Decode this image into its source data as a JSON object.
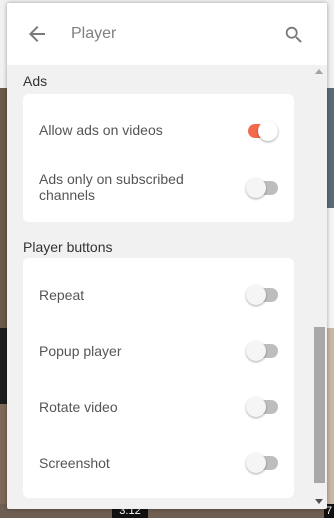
{
  "header": {
    "title": "Player",
    "back_icon": "arrow-back-icon",
    "search_icon": "search-icon"
  },
  "sections": [
    {
      "title": "Ads",
      "items": [
        {
          "label": "Allow ads on videos",
          "enabled": true
        },
        {
          "label": "Ads only on subscribed channels",
          "enabled": false
        }
      ]
    },
    {
      "title": "Player buttons",
      "items": [
        {
          "label": "Repeat",
          "enabled": false
        },
        {
          "label": "Popup player",
          "enabled": false
        },
        {
          "label": "Rotate video",
          "enabled": false
        },
        {
          "label": "Screenshot",
          "enabled": false
        }
      ]
    }
  ],
  "background": {
    "duration_left": "3:12",
    "duration_right": "7"
  },
  "colors": {
    "accent": "#f26a4b",
    "toggle_off_track": "#bdbdbd",
    "panel_bg": "#f1f1f1",
    "card_bg": "#ffffff"
  }
}
